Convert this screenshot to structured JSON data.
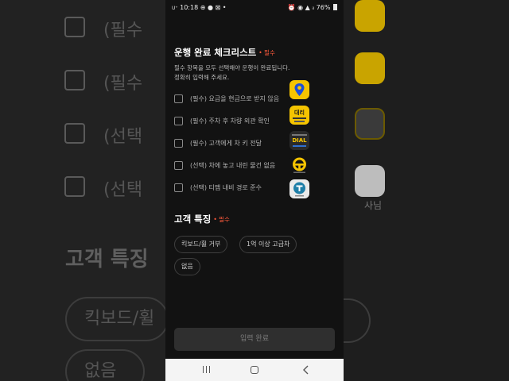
{
  "status_bar": {
    "time": "10:18",
    "battery": "76%"
  },
  "checklist": {
    "title": "운행 완료 체크리스트",
    "required_badge": "• 필수",
    "description_line1": "필수 항목을 모두 선택해야 운행이 완료됩니다.",
    "description_line2": "정확히 입력해 주세요.",
    "items": [
      {
        "label": "(필수) 요금을 현금으로 받지 않음"
      },
      {
        "label": "(필수) 주차 후 차량 외관 확인"
      },
      {
        "label": "(필수) 고객에게 차 키 전달"
      },
      {
        "label": "(선택) 차에 놓고 내린 물건 없음"
      },
      {
        "label": "(선택) 티맵 내비 경로 준수"
      }
    ]
  },
  "customer_traits": {
    "title": "고객 특징",
    "required_badge": "• 필수",
    "chips": [
      {
        "label": "킥보드/휠 거부"
      },
      {
        "label": "1억 이상 고급차"
      },
      {
        "label": "없음"
      }
    ]
  },
  "submit_label": "입력 완료",
  "background": {
    "row_texts": [
      "(필수",
      "(필수",
      "(선택",
      "(선택"
    ],
    "section_title": "고객 특징",
    "chip_texts": [
      "킥보드/휠",
      "없음"
    ],
    "right_label": "사님"
  },
  "app_icons": [
    {
      "icon": "location-pin-icon"
    },
    {
      "icon": "daeri-app-icon",
      "text": "대리"
    },
    {
      "icon": "dial-app-icon",
      "text": "DIAL"
    },
    {
      "icon": "steering-wheel-icon"
    },
    {
      "icon": "tmap-icon"
    }
  ],
  "colors": {
    "required": "#ff5a3c",
    "background": "#121212",
    "app_yellow": "#f5c400"
  }
}
